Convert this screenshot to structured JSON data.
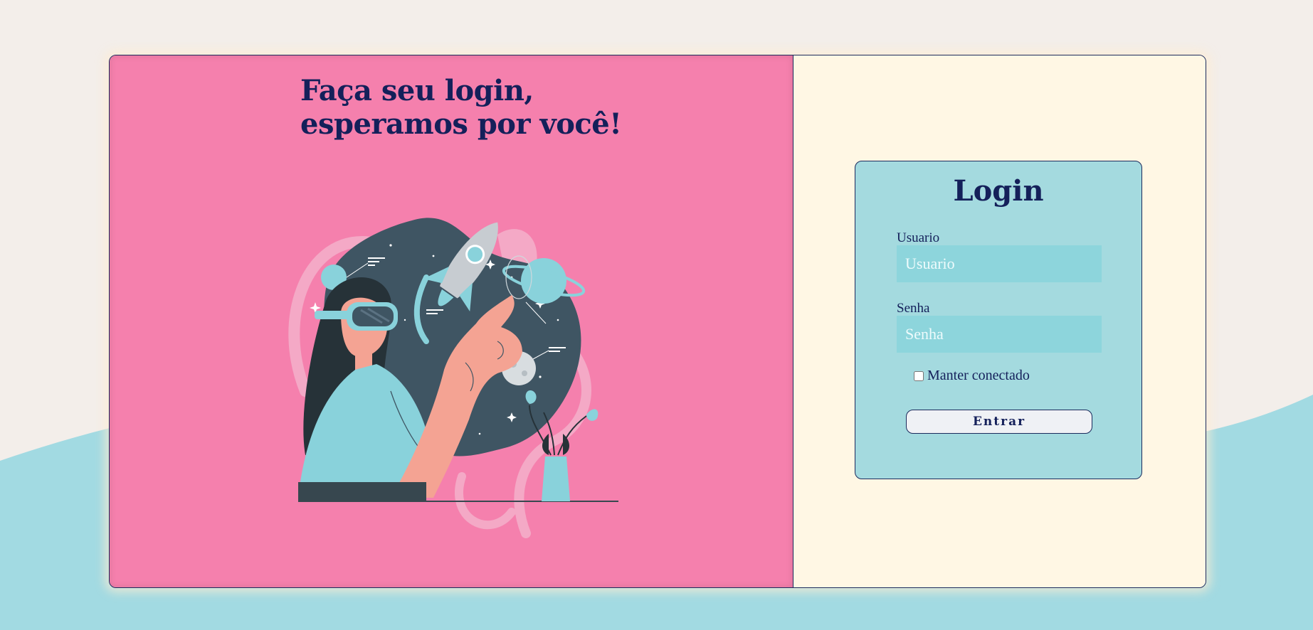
{
  "hero": {
    "headline_line1": "Faça seu login,",
    "headline_line2": "esperamos por você!"
  },
  "login": {
    "title": "Login",
    "username_label": "Usuario",
    "username_placeholder": "Usuario",
    "password_label": "Senha",
    "password_placeholder": "Senha",
    "remember_label": "Manter conectado",
    "remember_checked": false,
    "submit_label": "Entrar"
  },
  "colors": {
    "page_background": "#f3eeea",
    "wave": "#a2dae2",
    "hero_panel": "#f580ad",
    "form_panel": "#fff7e4",
    "login_box": "#a4dadf",
    "input_fill": "#8dd5dc",
    "text_navy": "#14205a"
  },
  "icons": {
    "illustration": "woman-vr-headset-space-illustration"
  }
}
